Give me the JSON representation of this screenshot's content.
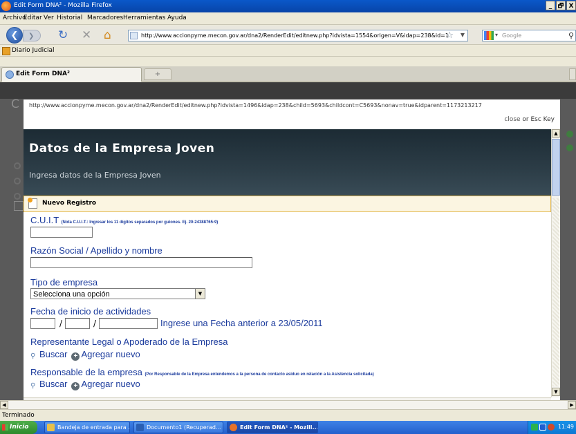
{
  "window": {
    "title": "Edit Form DNA² - Mozilla Firefox",
    "buttons": [
      "_",
      "🗗",
      "X"
    ]
  },
  "menu": [
    "Archivo",
    "Editar",
    "Ver",
    "Historial",
    "Marcadores",
    "Herramientas",
    "Ayuda"
  ],
  "nav": {
    "url": "http://www.accionpyme.mecon.gov.ar/dna2/RenderEdit/editnew.php?idvista=1554&origen=V&idap=238&id=1",
    "search_placeholder": "Google"
  },
  "bookmarks": [
    "Diario Judicial"
  ],
  "tabs": [
    {
      "label": "Edit Form DNA²",
      "active": true
    }
  ],
  "new_tab_symbol": "+",
  "background_page": {
    "letter": "C"
  },
  "lightbox": {
    "url": "http://www.accionpyme.mecon.gov.ar/dna2/RenderEdit/editnew.php?idvista=1496&idap=238&child=5693&childcont=C5693&nonav=true&idparent=1173213217",
    "close_label": "close",
    "close_suffix": "or Esc Key"
  },
  "form": {
    "header": {
      "title": "Datos de la Empresa Joven",
      "subtitle": "Ingresa datos de la Empresa Joven"
    },
    "section": "Nuevo Registro",
    "cuit": {
      "label": "C.U.I.T",
      "note": "(Nota C.U.I.T.: Ingresar los 11 dígitos separados por guiones. Ej. 20-24388765-9)",
      "value": ""
    },
    "razon_social": {
      "label": "Razón Social / Apellido y nombre",
      "value": ""
    },
    "tipo_empresa": {
      "label": "Tipo de empresa",
      "selected": "Selecciona una opción"
    },
    "fecha_inicio": {
      "label": "Fecha de inicio de actividades",
      "separator": "/",
      "hint": "Ingrese una Fecha anterior a 23/05/2011"
    },
    "representante": {
      "label": "Representante Legal o Apoderado de la Empresa",
      "buscar": "Buscar",
      "agregar": "Agregar nuevo"
    },
    "responsable": {
      "label": "Responsable de la empresa",
      "note": "(Por Responsable de la Empresa entendemos a la persona de contacto asiduo en relación a la Asistencia solicitada)",
      "buscar": "Buscar",
      "agregar": "Agregar nuevo"
    }
  },
  "status": "Terminado",
  "taskbar": {
    "start": "Inicio",
    "items": [
      {
        "label": "Bandeja de entrada para ...",
        "color": "#e8c04a",
        "active": false
      },
      {
        "label": "Documento1 (Recuperad...",
        "color": "#2a5fb3",
        "active": false
      },
      {
        "label": "Edit Form DNA² - Mozill...",
        "color": "#e6722a",
        "active": true
      }
    ],
    "clock": "11:49"
  },
  "colors": {
    "label_blue": "#1a3a9c",
    "hero_dark": "#1c2b34",
    "section_border": "#e4b74b",
    "section_bg": "#fbf5e1"
  },
  "icons": [
    "firefox-icon",
    "back-icon",
    "forward-icon",
    "reload-icon",
    "stop-icon",
    "home-icon",
    "page-icon",
    "star-icon",
    "google-icon",
    "search-icon",
    "bookmark-icon",
    "new-document-icon",
    "magnifier-icon",
    "add-icon"
  ]
}
